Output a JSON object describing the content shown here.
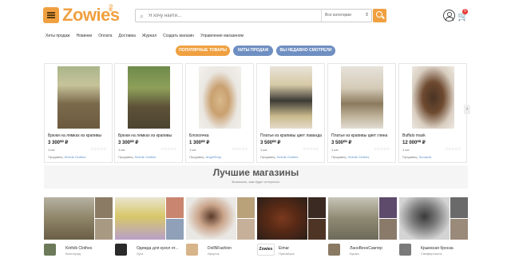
{
  "header": {
    "logo": "Zowies",
    "logo_suffix": "RU",
    "search_placeholder": "Я хочу найти...",
    "category_select": "Все категории",
    "cart_count": "0"
  },
  "nav": [
    "Хиты продаж",
    "Новинки",
    "Оплата",
    "Доставка",
    "Журнал",
    "Создать магазин",
    "Управление магазином"
  ],
  "tabs": [
    {
      "label": "ПОПУЛЯРНЫЕ ТОВАРЫ",
      "color": "#f0a040"
    },
    {
      "label": "ХИТЫ ПРОДАЖ",
      "color": "#6f8fc2"
    },
    {
      "label": "ВЫ НЕДАВНО СМОТРЕЛИ",
      "color": "#6f8fc2"
    }
  ],
  "products": [
    {
      "title": "Брюки на лямках из крапивы",
      "price": "3 300⁰⁰ ₽",
      "qty": "1 шт.",
      "seller_label": "Продавец:",
      "seller": "Kinfolk Clothes"
    },
    {
      "title": "Брюки на лямках из крапивы",
      "price": "3 300⁰⁰ ₽",
      "qty": "1 шт.",
      "seller_label": "Продавец:",
      "seller": "Kinfolk Clothes"
    },
    {
      "title": "Блохоячка",
      "price": "1 300⁰⁰ ₽",
      "qty": "1 шт.",
      "seller_label": "Продавец:",
      "seller": "AngelShop"
    },
    {
      "title": "Платье из крапивы цвет лаванда",
      "price": "3 500⁰⁰ ₽",
      "qty": "1 шт.",
      "seller_label": "Продавец:",
      "seller": "Kinfolk Clothes"
    },
    {
      "title": "Платье из крапивы цвет глина",
      "price": "3 500⁰⁰ ₽",
      "qty": "1 шт.",
      "seller_label": "Продавец:",
      "seller": "Kinfolk Clothes"
    },
    {
      "title": "Buffalo mask",
      "price": "12 000⁰⁰ ₽",
      "qty": "1 шт.",
      "seller_label": "Продавец:",
      "seller": "Sumavia"
    }
  ],
  "best": {
    "title": "Лучшие магазины",
    "subtitle": "Возможно, вам будет интересно"
  },
  "shops": [
    {
      "name": "Kinfolk Clothes",
      "city": "Волгоград"
    },
    {
      "name": "Одежда для кукол от...",
      "city": "Луга"
    },
    {
      "name": "DollNFashion",
      "city": "Иркутск"
    },
    {
      "name": "Eimar",
      "city": "Приозёрск",
      "logo_text": "Zowies"
    },
    {
      "name": "ЛаннВеннСамтер",
      "city": "Кушка"
    },
    {
      "name": "Крымская бронза",
      "city": "Симферополь"
    }
  ]
}
